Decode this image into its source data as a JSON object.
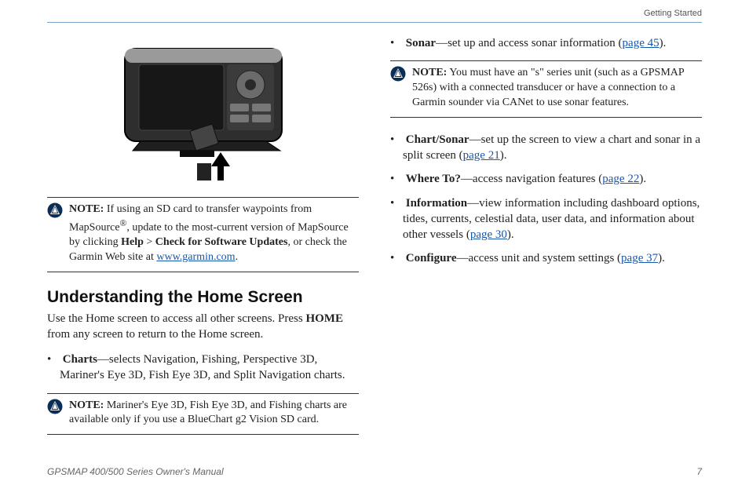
{
  "header": {
    "section": "Getting Started"
  },
  "left": {
    "note1": {
      "label": "NOTE:",
      "pre": " If using an SD card to transfer waypoints from MapSource",
      "sup": "®",
      "mid": ", update to the most-current version of MapSource by clicking ",
      "help": "Help",
      "gt": " > ",
      "check": "Check for Software Updates",
      "post": ", or check the Garmin Web site at ",
      "link": "www.garmin.com",
      "period": "."
    },
    "heading": "Understanding the Home Screen",
    "intro_a": "Use the Home screen to access all other screens. Press ",
    "intro_home": "HOME",
    "intro_b": " from any screen to return to the Home screen.",
    "charts_label": "Charts",
    "charts_text": "—selects Navigation, Fishing, Perspective 3D, Mariner's Eye 3D, Fish Eye 3D, and Split Navigation charts.",
    "note2": {
      "label": "NOTE:",
      "text": " Mariner's Eye 3D, Fish Eye 3D, and Fishing charts are available only if you use a BlueChart g2 Vision SD card."
    }
  },
  "right": {
    "sonar_label": "Sonar",
    "sonar_text_a": "—set up and access sonar information (",
    "sonar_link": "page 45",
    "sonar_text_b": ").",
    "note": {
      "label": "NOTE:",
      "text": " You must have an \"s\" series unit (such as a GPSMAP 526s) with a connected transducer or have a connection to a Garmin sounder via CANet to use sonar features."
    },
    "chartsonar_label": "Chart/Sonar",
    "chartsonar_text_a": "—set up the screen to view a chart and sonar in a split screen (",
    "chartsonar_link": "page 21",
    "chartsonar_text_b": ").",
    "where_label": "Where To?",
    "where_text_a": "—access navigation features (",
    "where_link": "page 22",
    "where_text_b": ").",
    "info_label": "Information",
    "info_text_a": "—view information including dashboard options, tides, currents, celestial data, user data, and information about other vessels (",
    "info_link": "page 30",
    "info_text_b": ").",
    "config_label": "Configure",
    "config_text_a": "—access unit and system settings (",
    "config_link": "page 37",
    "config_text_b": ")."
  },
  "footer": {
    "left": "GPSMAP 400/500 Series Owner's Manual",
    "right": "7"
  }
}
